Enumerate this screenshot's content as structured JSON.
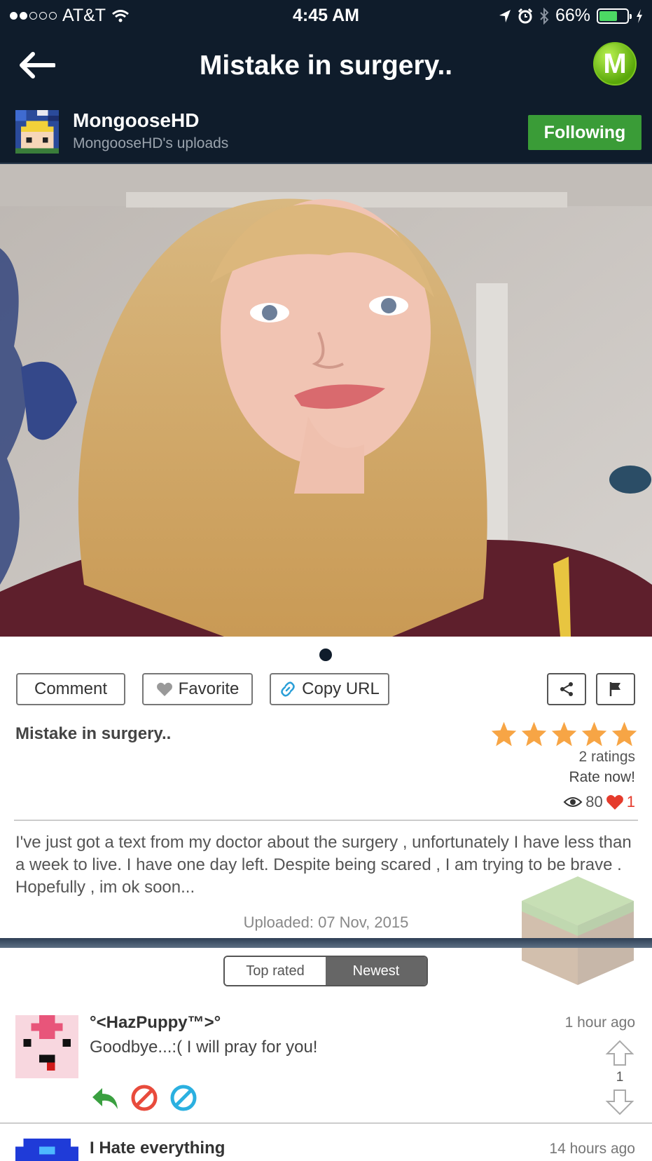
{
  "status_bar": {
    "carrier": "AT&T",
    "time": "4:45 AM",
    "battery": "66%",
    "battery_level": 0.66
  },
  "header": {
    "title": "Mistake in surgery..",
    "logo_letter": "M"
  },
  "uploader": {
    "name": "MongooseHD",
    "subtitle": "MongooseHD's uploads",
    "follow_label": "Following"
  },
  "actions": {
    "comment": "Comment",
    "favorite": "Favorite",
    "copy_url": "Copy URL"
  },
  "video": {
    "title": "Mistake in surgery..",
    "stars": 5,
    "ratings": "2 ratings",
    "rate_now": "Rate now!",
    "views": "80",
    "likes": "1",
    "description": "I've just got a text from my doctor about the surgery , unfortunately I have less than a week to live. I have one day left. Despite being scared , I am trying to be brave . Hopefully , im ok soon...",
    "uploaded": "Uploaded: 07 Nov, 2015"
  },
  "sort": {
    "top_rated": "Top rated",
    "newest": "Newest",
    "active": "Newest"
  },
  "comments": [
    {
      "name": "°<HazPuppy™>°",
      "time": "1 hour ago",
      "text": "Goodbye...:( I will pray for you!",
      "votes": "1"
    },
    {
      "name": "I Hate everything",
      "time": "14 hours ago"
    }
  ],
  "colors": {
    "header_bg": "#0f1c2b",
    "follow_green": "#3a9c37",
    "star_orange": "#f7a545",
    "like_red": "#e53b2c"
  }
}
